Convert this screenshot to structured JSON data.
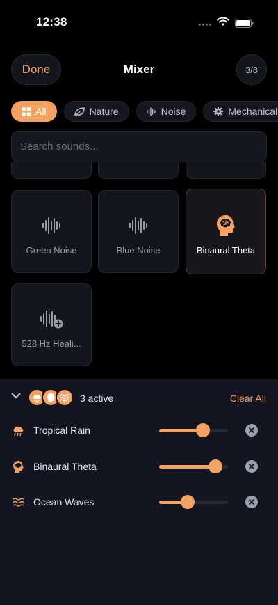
{
  "status_bar": {
    "time": "12:38"
  },
  "header": {
    "done_label": "Done",
    "title": "Mixer",
    "count": "3/8"
  },
  "categories": [
    {
      "label": "All",
      "icon": "grid-icon",
      "active": true
    },
    {
      "label": "Nature",
      "icon": "leaf-icon",
      "active": false
    },
    {
      "label": "Noise",
      "icon": "waveform-icon",
      "active": false
    },
    {
      "label": "Mechanical",
      "icon": "gear-icon",
      "active": false
    }
  ],
  "search": {
    "placeholder": "Search sounds...",
    "value": ""
  },
  "sounds": [
    {
      "label": "Green Noise",
      "icon": "waveform-icon",
      "selected": false
    },
    {
      "label": "Blue Noise",
      "icon": "waveform-icon",
      "selected": false
    },
    {
      "label": "Binaural Theta",
      "icon": "brain-head-icon",
      "selected": true
    },
    {
      "label": "528 Hz Heali...",
      "icon": "waveform-plus-icon",
      "selected": false
    }
  ],
  "panel": {
    "active_label": "3 active",
    "clear_all_label": "Clear All",
    "mixes": [
      {
        "label": "Tropical Rain",
        "icon": "cloud-rain-icon",
        "volume": 0.64
      },
      {
        "label": "Binaural Theta",
        "icon": "brain-head-icon",
        "volume": 0.82
      },
      {
        "label": "Ocean Waves",
        "icon": "waves-icon",
        "volume": 0.41
      }
    ]
  },
  "colors": {
    "accent": "#f3a262",
    "background": "#000000",
    "panel": "#131520",
    "tile": "#15161c"
  }
}
